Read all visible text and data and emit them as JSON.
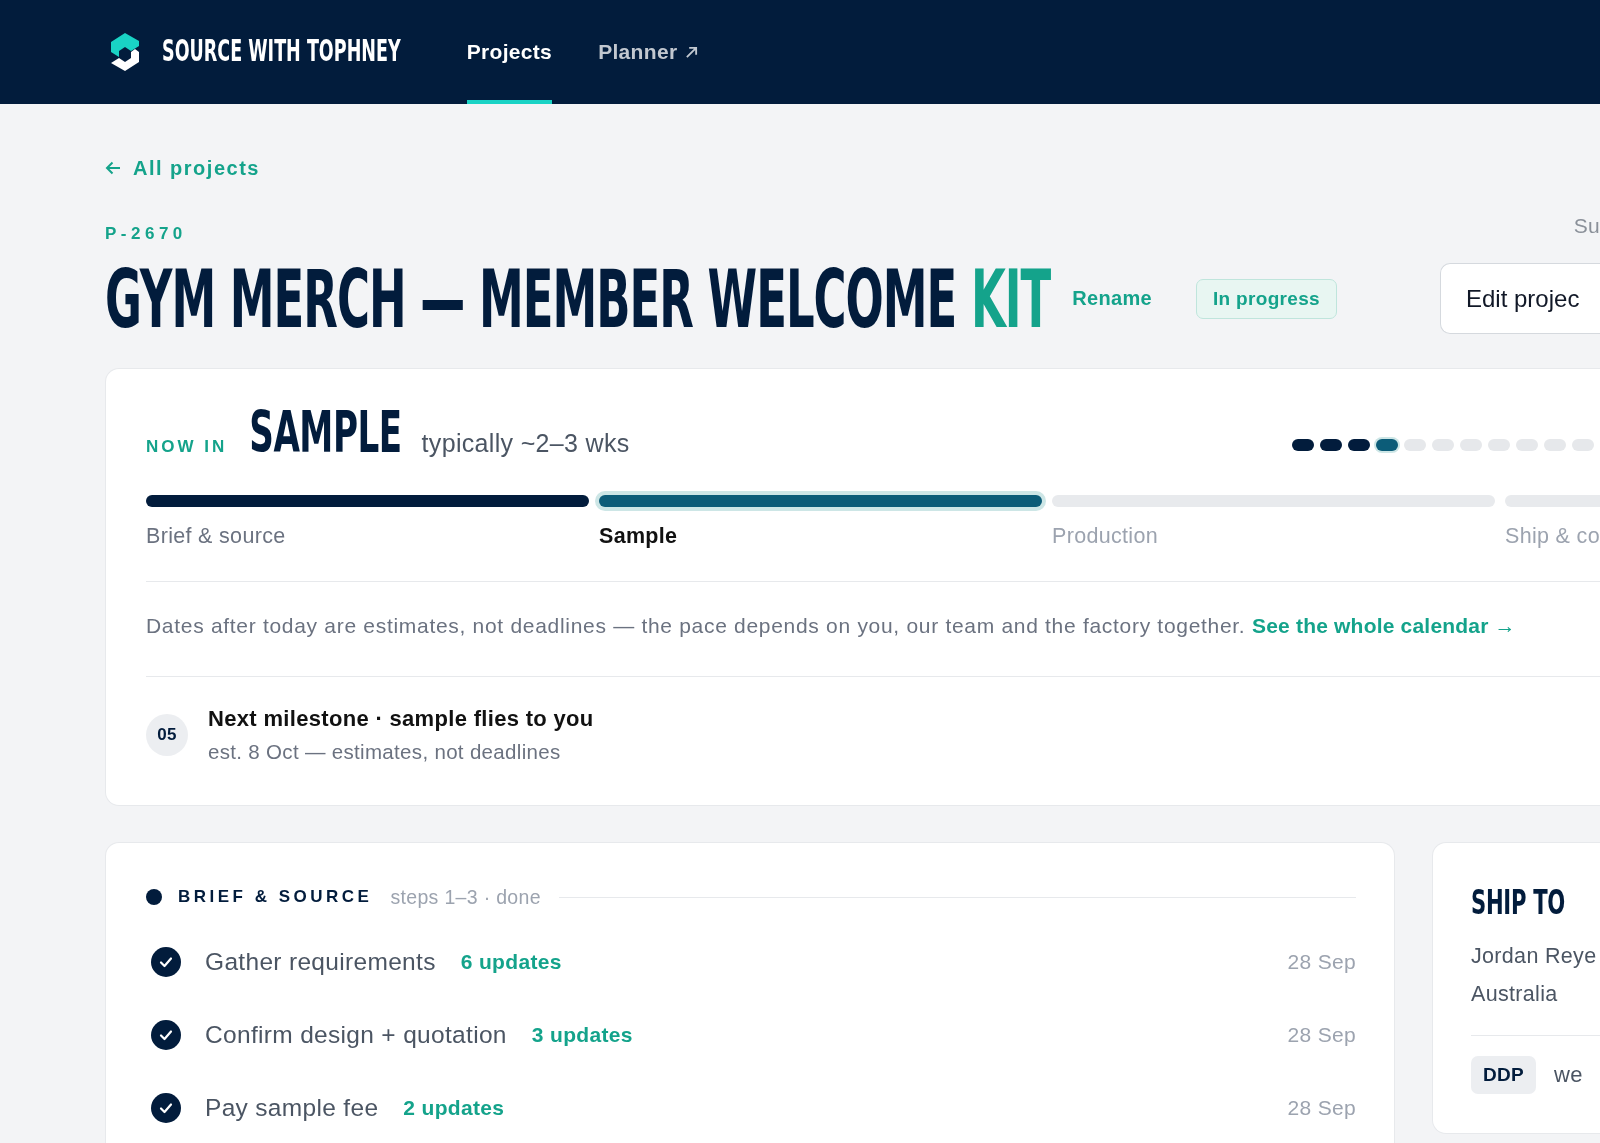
{
  "header": {
    "brand": "SOURCE WITH TOPHNEY",
    "nav": [
      {
        "label": "Projects",
        "selected": true,
        "external": false
      },
      {
        "label": "Planner",
        "selected": false,
        "external": true
      }
    ]
  },
  "back_link": "All projects",
  "project": {
    "code": "P-2670",
    "corner_text": "Su",
    "title": "GYM MERCH — MEMBER WELCOME",
    "title_accent": "KIT",
    "rename": "Rename",
    "status": "In progress",
    "edit_button": "Edit projec"
  },
  "stage": {
    "label": "NOW IN",
    "name": "SAMPLE",
    "duration": "typically ~2–3 wks",
    "dots": [
      {
        "kind": "done"
      },
      {
        "kind": "done"
      },
      {
        "kind": "done"
      },
      {
        "kind": "current"
      },
      {
        "kind": "upcoming"
      },
      {
        "kind": "upcoming"
      },
      {
        "kind": "upcoming"
      },
      {
        "kind": "upcoming"
      },
      {
        "kind": "upcoming"
      },
      {
        "kind": "upcoming"
      },
      {
        "kind": "upcoming"
      }
    ],
    "phases": [
      {
        "label": "Brief & source",
        "kind": "done"
      },
      {
        "label": "Sample",
        "kind": "current"
      },
      {
        "label": "Production",
        "kind": "upcoming"
      },
      {
        "label": "Ship & co",
        "kind": "upcoming"
      }
    ],
    "note": "Dates after today are estimates, not deadlines — the pace depends on you, our team and the factory together.",
    "note_link": "See the whole calendar →",
    "milestone": {
      "number": "05",
      "title": "Next milestone · sample flies to you",
      "subtitle": "est. 8 Oct — estimates, not deadlines"
    }
  },
  "steps_section": {
    "title": "BRIEF & SOURCE",
    "meta": "steps 1–3 · done",
    "steps": [
      {
        "label": "Gather requirements",
        "updates": "6 updates",
        "date": "28 Sep",
        "done": true
      },
      {
        "label": "Confirm design + quotation",
        "updates": "3 updates",
        "date": "28 Sep",
        "done": true
      },
      {
        "label": "Pay sample fee",
        "updates": "2 updates",
        "date": "28 Sep",
        "done": true
      }
    ]
  },
  "ship_to": {
    "title": "SHIP TO",
    "lines": [
      "Jordan Reye",
      "Australia"
    ],
    "terms_badge": "DDP",
    "terms_text": "we"
  }
}
